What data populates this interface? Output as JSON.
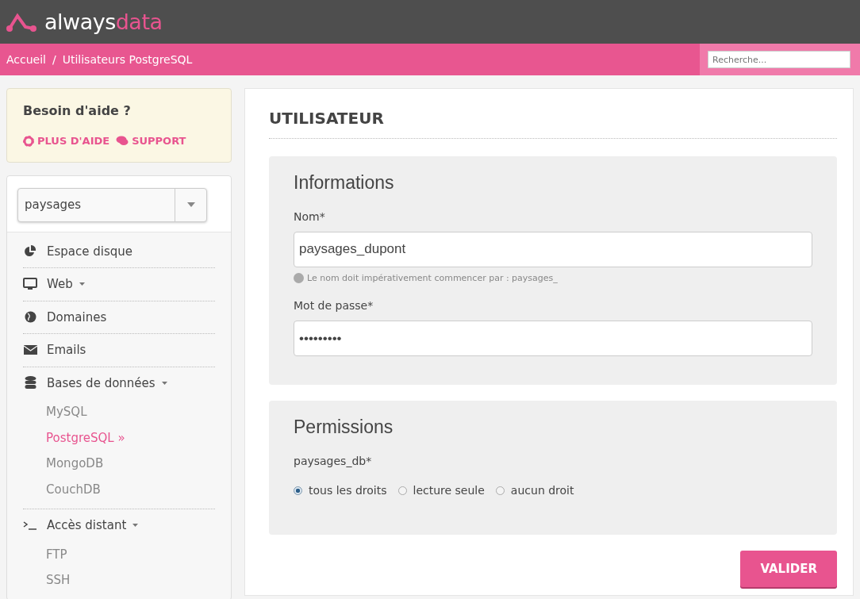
{
  "brand": {
    "part_1": "always",
    "part_2": "data"
  },
  "breadcrumb": {
    "separator": "/",
    "items": [
      "Accueil",
      "Utilisateurs PostgreSQL"
    ]
  },
  "search": {
    "placeholder": "Recherche..."
  },
  "help": {
    "title": "Besoin d'aide ?",
    "links": [
      {
        "label": "PLUS D'AIDE",
        "kind": "lifebuoy"
      },
      {
        "label": "SUPPORT",
        "kind": "chat"
      }
    ]
  },
  "account_select": {
    "value": "paysages"
  },
  "sidebar": {
    "items": [
      {
        "label": "Espace disque"
      },
      {
        "label": "Web",
        "dropdown": true
      },
      {
        "label": "Domaines"
      },
      {
        "label": "Emails"
      },
      {
        "label": "Bases de données",
        "dropdown": true,
        "children": [
          {
            "label": "MySQL",
            "selected": false
          },
          {
            "label": "PostgreSQL »",
            "selected": true
          },
          {
            "label": "MongoDB",
            "selected": false
          },
          {
            "label": "CouchDB",
            "selected": false
          }
        ]
      },
      {
        "label": "Accès distant",
        "dropdown": true,
        "children": [
          {
            "label": "FTP",
            "selected": false
          },
          {
            "label": "SSH",
            "selected": false
          }
        ]
      }
    ]
  },
  "page_title": "UTILISATEUR",
  "informations": {
    "title": "Informations",
    "fields": [
      {
        "label": "Nom*",
        "value": "paysages_dupont",
        "help": "Le nom doit impérativement commencer par : paysages_"
      },
      {
        "label": "Mot de passe*",
        "value": "•••••••••"
      }
    ]
  },
  "permissions": {
    "title": "Permissions",
    "database": "paysages_db*",
    "options": [
      {
        "label": "tous les droits",
        "selected": true
      },
      {
        "label": "lecture seule",
        "selected": false
      },
      {
        "label": "aucun droit",
        "selected": false
      }
    ]
  },
  "submit": "VALIDER"
}
